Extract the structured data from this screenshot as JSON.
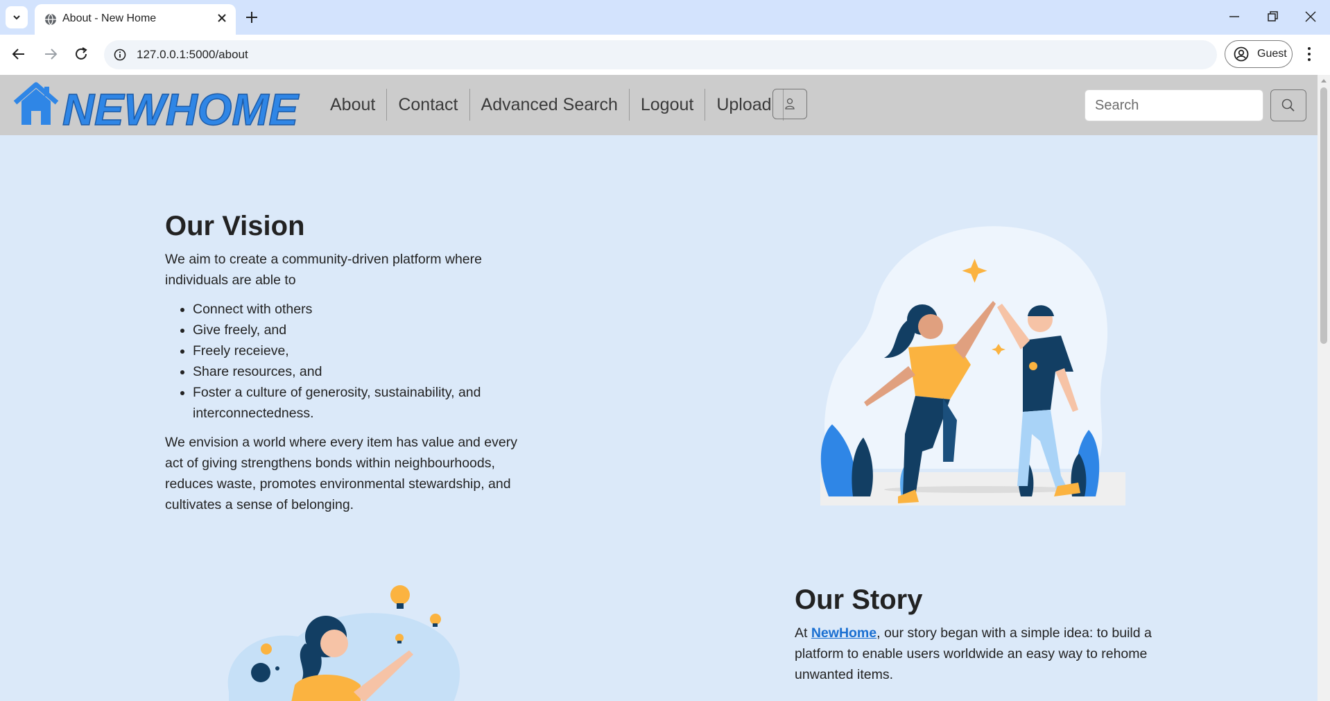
{
  "browser": {
    "tab_title": "About - New Home",
    "url": "127.0.0.1:5000/about",
    "profile_label": "Guest"
  },
  "navbar": {
    "brand": "NEWHOME",
    "links": [
      "About",
      "Contact",
      "Advanced Search",
      "Logout",
      "Upload"
    ],
    "search_placeholder": "Search"
  },
  "vision": {
    "heading": "Our Vision",
    "intro": "We aim to create a community-driven platform where individuals are able to",
    "items": [
      "Connect with others",
      "Give freely, and",
      "Freely receieve,",
      "Share resources, and",
      "Foster a culture of generosity, sustainability, and interconnectedness."
    ],
    "closing": "We envision a world where every item has value and every act of giving strengthens bonds within neighbourhoods, reduces waste, promotes environmental stewardship, and cultivates a sense of belonging."
  },
  "story": {
    "heading": "Our Story",
    "prefix": "At ",
    "link": "NewHome",
    "text": ", our story began with a simple idea: to build a platform to enable users worldwide an easy way to rehome unwanted items."
  },
  "colors": {
    "page_bg": "#dbe9f9",
    "navbar_bg": "#cccccc",
    "brand_blue": "#2f86e6",
    "illustration_navy": "#123e63",
    "illustration_yellow": "#fbb340"
  }
}
